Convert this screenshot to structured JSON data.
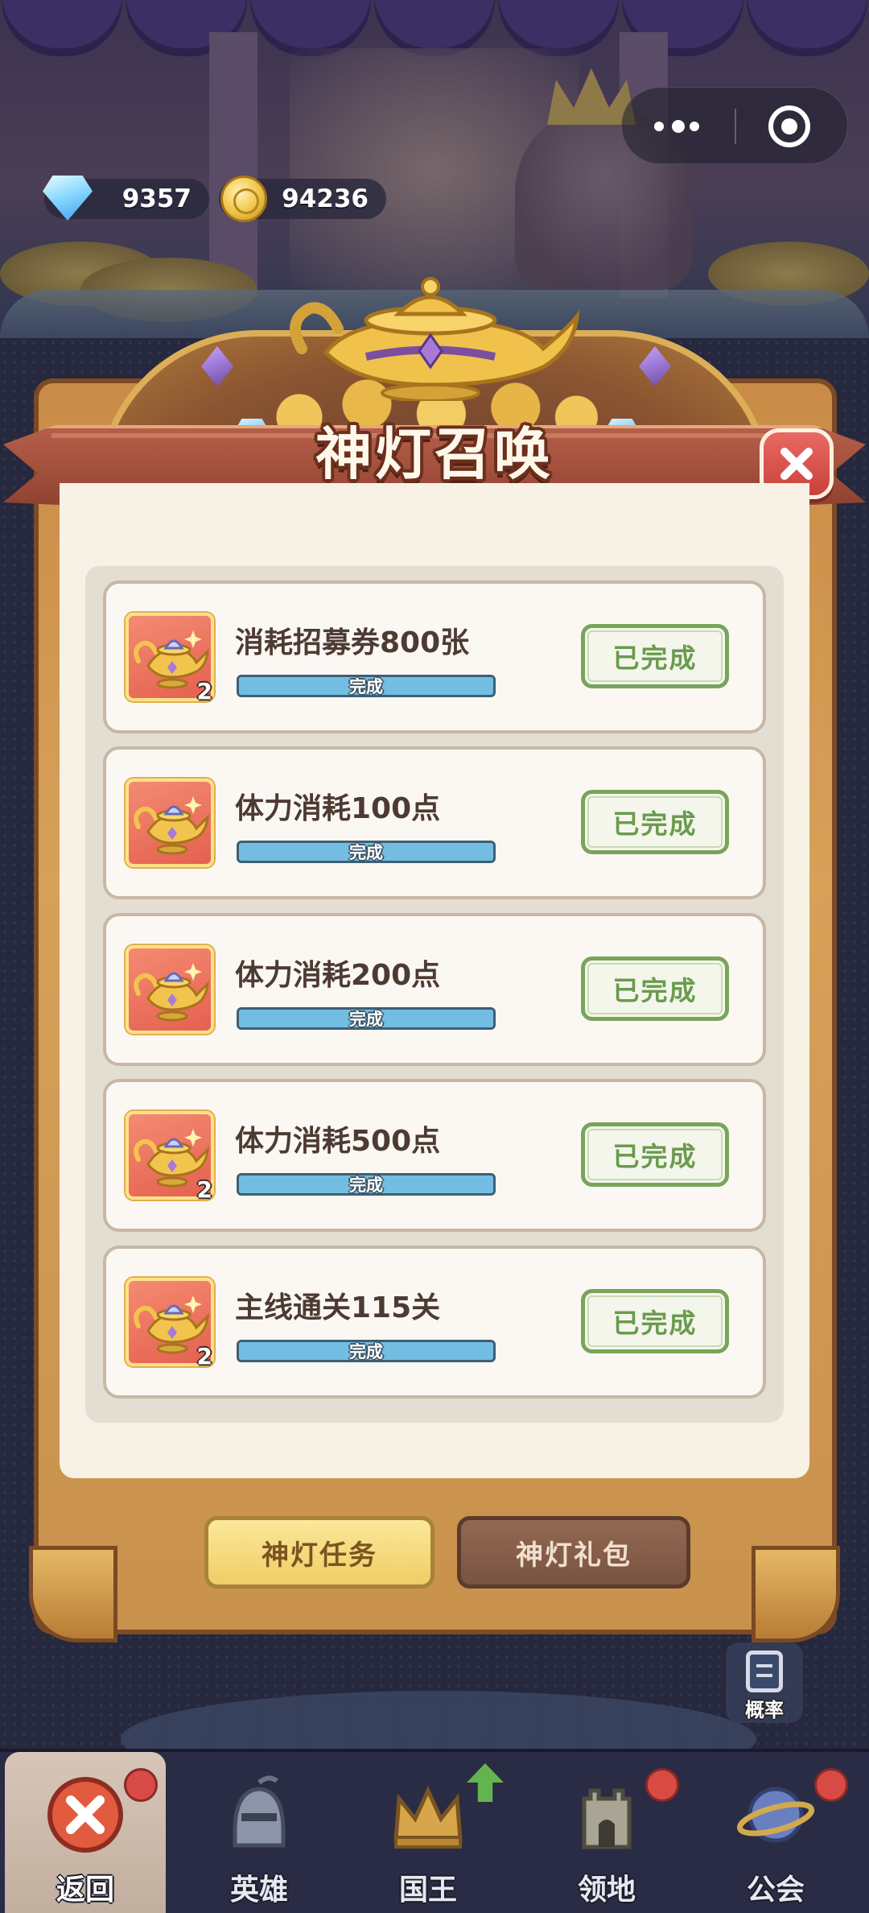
{
  "currencies": {
    "gems": "9357",
    "coins": "94236"
  },
  "panel": {
    "title": "神灯召唤"
  },
  "tasks": [
    {
      "title": "消耗招募券800张",
      "reward_count": "2",
      "progress_label": "完成",
      "progress": 1.0,
      "status": "已完成"
    },
    {
      "title": "体力消耗100点",
      "reward_count": "",
      "progress_label": "完成",
      "progress": 1.0,
      "status": "已完成"
    },
    {
      "title": "体力消耗200点",
      "reward_count": "",
      "progress_label": "完成",
      "progress": 1.0,
      "status": "已完成"
    },
    {
      "title": "体力消耗500点",
      "reward_count": "2",
      "progress_label": "完成",
      "progress": 1.0,
      "status": "已完成"
    },
    {
      "title": "主线通关115关",
      "reward_count": "2",
      "progress_label": "完成",
      "progress": 1.0,
      "status": "已完成"
    }
  ],
  "tabs": {
    "lamp_tasks": "神灯任务",
    "lamp_gift": "神灯礼包"
  },
  "probability_label": "概率",
  "nav": [
    {
      "label": "返回",
      "icon": "close-icon",
      "badge": true
    },
    {
      "label": "英雄",
      "icon": "knight-helmet-icon",
      "badge": false
    },
    {
      "label": "国王",
      "icon": "crown-icon",
      "badge": false,
      "upgrade_arrow": true
    },
    {
      "label": "领地",
      "icon": "castle-tower-icon",
      "badge": true
    },
    {
      "label": "公会",
      "icon": "planet-icon",
      "badge": true
    }
  ],
  "colors": {
    "done_green": "#78a55b",
    "ribbon_red": "#9c4a38",
    "active_tab": "#f0cd66",
    "alert_red": "#d84b45"
  }
}
